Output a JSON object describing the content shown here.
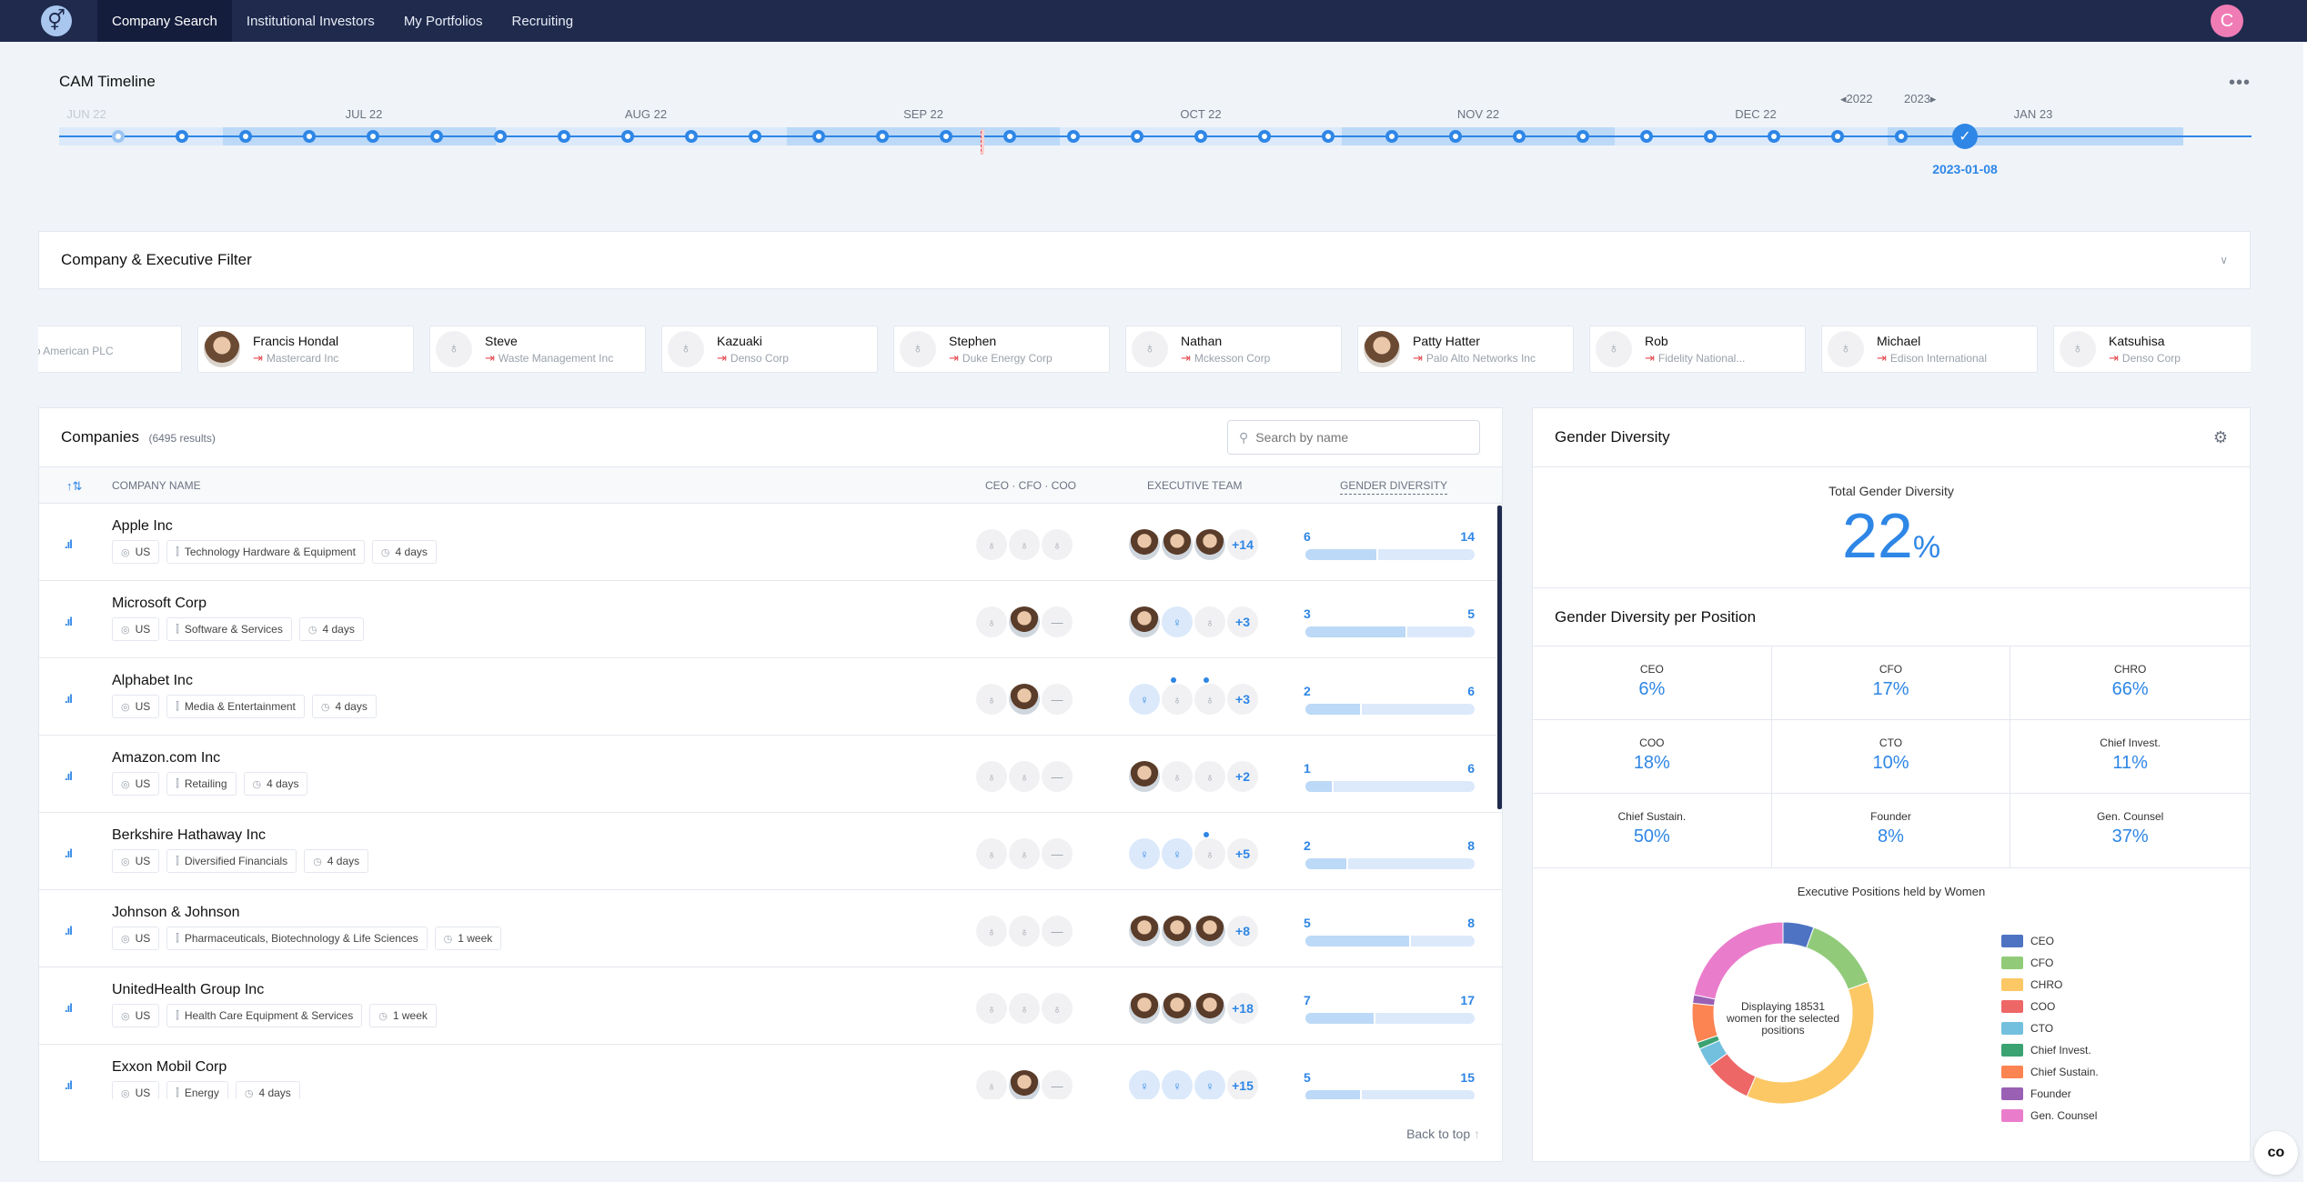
{
  "nav": {
    "logo_icon": "gender-symbol-icon",
    "tabs": [
      {
        "label": "Company Search",
        "active": true
      },
      {
        "label": "Institutional Investors",
        "active": false
      },
      {
        "label": "My Portfolios",
        "active": false
      },
      {
        "label": "Recruiting",
        "active": false
      }
    ],
    "user_initial": "C"
  },
  "timeline": {
    "title": "CAM Timeline",
    "more_icon": "more-horizontal-icon",
    "months": [
      "JUN 22",
      "JUL 22",
      "AUG 22",
      "SEP 22",
      "OCT 22",
      "NOV 22",
      "DEC 22",
      "JAN 23"
    ],
    "year_prev": "2022",
    "year_next": "2023",
    "selected_date": "2023-01-08"
  },
  "filter": {
    "title": "Company & Executive Filter"
  },
  "executives": [
    {
      "name": "",
      "company": "o American PLC",
      "photo": false
    },
    {
      "name": "Francis Hondal",
      "company": "Mastercard Inc",
      "photo": true
    },
    {
      "name": "Steve",
      "company": "Waste Management Inc",
      "photo": false
    },
    {
      "name": "Kazuaki",
      "company": "Denso Corp",
      "photo": false
    },
    {
      "name": "Stephen",
      "company": "Duke Energy Corp",
      "photo": false
    },
    {
      "name": "Nathan",
      "company": "Mckesson Corp",
      "photo": false
    },
    {
      "name": "Patty Hatter",
      "company": "Palo Alto Networks Inc",
      "photo": true
    },
    {
      "name": "Rob",
      "company": "Fidelity National...",
      "photo": false
    },
    {
      "name": "Michael",
      "company": "Edison International",
      "photo": false
    },
    {
      "name": "Katsuhisa",
      "company": "Denso Corp",
      "photo": false
    }
  ],
  "companies": {
    "title": "Companies",
    "count": "(6495 results)",
    "search_placeholder": "Search by name",
    "columns": {
      "name": "COMPANY NAME",
      "cxo": "CEO · CFO · COO",
      "team": "EXECUTIVE TEAM",
      "diversity": "GENDER DIVERSITY"
    },
    "back_to_top": "Back to top",
    "rows": [
      {
        "name": "Apple Inc",
        "country": "US",
        "industry": "Technology Hardware & Equipment",
        "updated": "4 days",
        "cxo": [
          "male",
          "male",
          "male"
        ],
        "team": [
          "photo",
          "photo",
          "photo"
        ],
        "team_dots": [
          false,
          false,
          false
        ],
        "more": "+14",
        "women": 6,
        "total": 14
      },
      {
        "name": "Microsoft Corp",
        "country": "US",
        "industry": "Software & Services",
        "updated": "4 days",
        "cxo": [
          "male",
          "photo",
          "none"
        ],
        "team": [
          "photo",
          "female",
          "male"
        ],
        "team_dots": [
          false,
          false,
          false
        ],
        "more": "+3",
        "women": 3,
        "total": 5
      },
      {
        "name": "Alphabet Inc",
        "country": "US",
        "industry": "Media & Entertainment",
        "updated": "4 days",
        "cxo": [
          "male",
          "photo",
          "none"
        ],
        "team": [
          "female",
          "male",
          "male"
        ],
        "team_dots": [
          false,
          true,
          true
        ],
        "more": "+3",
        "women": 2,
        "total": 6
      },
      {
        "name": "Amazon.com Inc",
        "country": "US",
        "industry": "Retailing",
        "updated": "4 days",
        "cxo": [
          "male",
          "male",
          "none"
        ],
        "team": [
          "photo",
          "male",
          "male"
        ],
        "team_dots": [
          false,
          false,
          false
        ],
        "more": "+2",
        "women": 1,
        "total": 6
      },
      {
        "name": "Berkshire Hathaway Inc",
        "country": "US",
        "industry": "Diversified Financials",
        "updated": "4 days",
        "cxo": [
          "male",
          "male",
          "none"
        ],
        "team": [
          "female",
          "female",
          "male"
        ],
        "team_dots": [
          false,
          false,
          true
        ],
        "more": "+5",
        "women": 2,
        "total": 8
      },
      {
        "name": "Johnson & Johnson",
        "country": "US",
        "industry": "Pharmaceuticals, Biotechnology & Life Sciences",
        "updated": "1 week",
        "cxo": [
          "male",
          "male",
          "none"
        ],
        "team": [
          "photo",
          "photo",
          "photo"
        ],
        "team_dots": [
          false,
          false,
          false
        ],
        "more": "+8",
        "women": 5,
        "total": 8
      },
      {
        "name": "UnitedHealth Group Inc",
        "country": "US",
        "industry": "Health Care Equipment & Services",
        "updated": "1 week",
        "cxo": [
          "male",
          "male",
          "male"
        ],
        "team": [
          "photo",
          "photo",
          "photo"
        ],
        "team_dots": [
          false,
          false,
          false
        ],
        "more": "+18",
        "women": 7,
        "total": 17
      },
      {
        "name": "Exxon Mobil Corp",
        "country": "US",
        "industry": "Energy",
        "updated": "4 days",
        "cxo": [
          "male",
          "photo",
          "none"
        ],
        "team": [
          "female",
          "female",
          "female"
        ],
        "team_dots": [
          false,
          false,
          false
        ],
        "more": "+15",
        "women": 5,
        "total": 15
      }
    ]
  },
  "gender": {
    "title": "Gender Diversity",
    "total_label": "Total Gender Diversity",
    "total_value": "22",
    "total_unit": "%",
    "per_position_title": "Gender Diversity per Position",
    "positions": [
      {
        "label": "CEO",
        "value": "6%"
      },
      {
        "label": "CFO",
        "value": "17%"
      },
      {
        "label": "CHRO",
        "value": "66%"
      },
      {
        "label": "COO",
        "value": "18%"
      },
      {
        "label": "CTO",
        "value": "10%"
      },
      {
        "label": "Chief Invest.",
        "value": "11%"
      },
      {
        "label": "Chief Sustain.",
        "value": "50%"
      },
      {
        "label": "Founder",
        "value": "8%"
      },
      {
        "label": "Gen. Counsel",
        "value": "37%"
      }
    ]
  },
  "chart_data": {
    "type": "pie",
    "title": "Executive Positions held by Women",
    "center_text": "Displaying 18531 women for the selected positions",
    "legend_position": "right",
    "categories": [
      "CEO",
      "CFO",
      "CHRO",
      "COO",
      "CTO",
      "Chief Invest.",
      "Chief Sustain.",
      "Founder",
      "Gen. Counsel"
    ],
    "values": [
      5.5,
      14,
      37,
      8.5,
      3.5,
      1.2,
      7,
      1.5,
      21.8
    ],
    "colors": [
      "#4e73c2",
      "#91cb7a",
      "#fcc865",
      "#ee6767",
      "#73c0de",
      "#3ba272",
      "#fc8452",
      "#9a60b4",
      "#ea7ccc"
    ]
  }
}
